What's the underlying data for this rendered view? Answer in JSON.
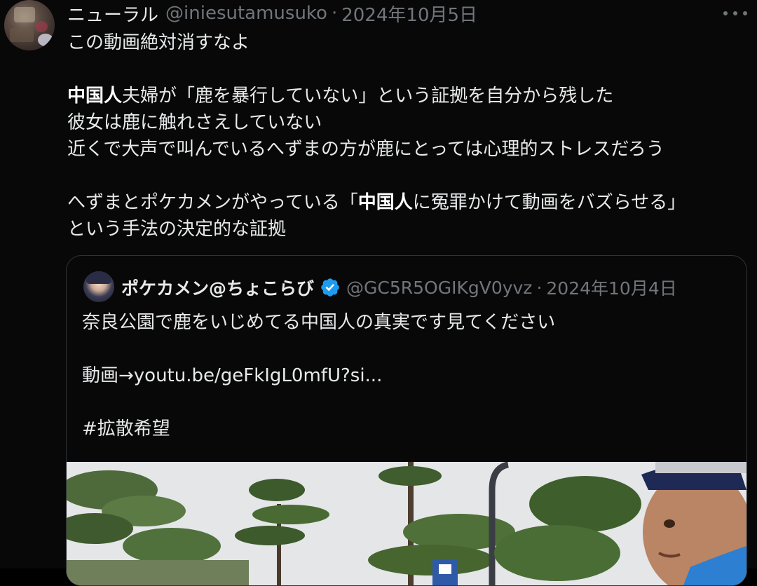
{
  "tweet": {
    "author_name": "ニューラル",
    "author_handle": "@iniesutamusuko",
    "separator": "·",
    "date": "2024年10月5日",
    "lines": [
      [
        {
          "t": "この動画絶対消すなよ",
          "b": false
        }
      ],
      [],
      [
        {
          "t": "中国人",
          "b": true
        },
        {
          "t": "夫婦が「鹿を暴行していない」という証拠を自分から残した",
          "b": false
        }
      ],
      [
        {
          "t": "彼女は鹿に触れさえしていない",
          "b": false
        }
      ],
      [
        {
          "t": "近くで大声で叫んでいるへずまの方が鹿にとっては心理的ストレスだろう",
          "b": false
        }
      ],
      [],
      [
        {
          "t": "へずまとポケカメンがやっている「",
          "b": false
        },
        {
          "t": "中国人",
          "b": true
        },
        {
          "t": "に冤罪かけて動画をバズらせる」",
          "b": false
        }
      ],
      [
        {
          "t": "という手法の決定的な証拠",
          "b": false
        }
      ]
    ]
  },
  "quote": {
    "author_name": "ポケカメン@ちょこらび",
    "verified": true,
    "author_handle": "@GC5R5OGIKgV0yvz",
    "separator": "·",
    "date": "2024年10月4日",
    "lines": [
      "奈良公園で鹿をいじめてる中国人の真実です見てください",
      "",
      "動画→youtu.be/geFkIgL0mfU?si...",
      "",
      " #拡散希望"
    ]
  },
  "icons": {
    "more": "more-horizontal-icon",
    "verified": "verified-badge-icon"
  },
  "colors": {
    "background": "#080808",
    "text": "#e7e9ea",
    "secondary": "#71767b",
    "border": "#2f3336",
    "verified": "#1d9bf0"
  }
}
